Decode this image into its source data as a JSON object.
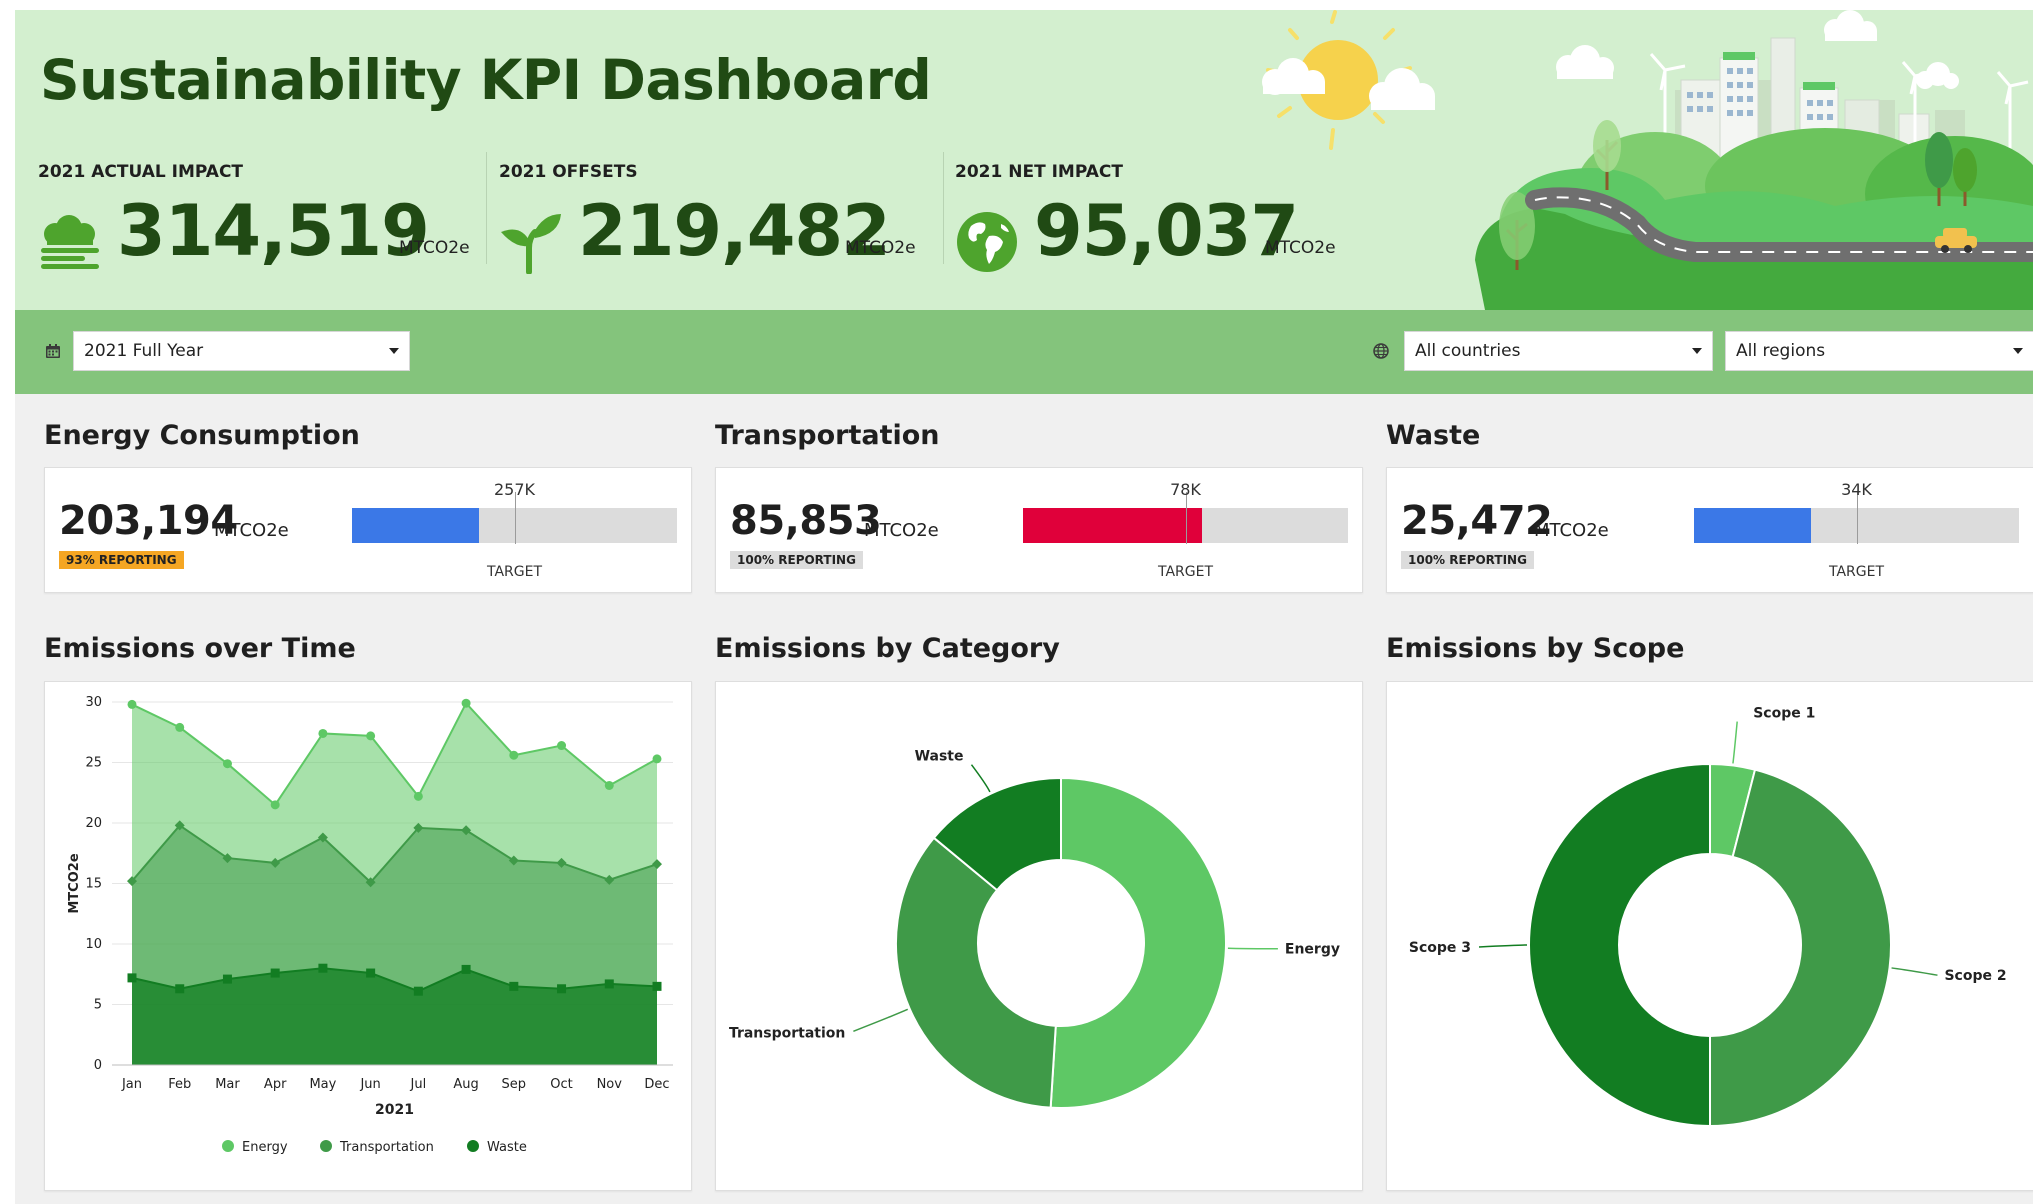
{
  "header": {
    "title": "Sustainability KPI Dashboard",
    "kpis": [
      {
        "label": "2021 ACTUAL IMPACT",
        "value": "314,519",
        "unit": "MTCO2e",
        "icon": "clouds-icon"
      },
      {
        "label": "2021 OFFSETS",
        "value": "219,482",
        "unit": "MTCO2e",
        "icon": "sprout-icon"
      },
      {
        "label": "2021 NET IMPACT",
        "value": "95,037",
        "unit": "MTCO2e",
        "icon": "globe-icon"
      }
    ]
  },
  "filters": {
    "period": "2021 Full Year",
    "country": "All countries",
    "region": "All regions",
    "period_icon": "calendar-icon",
    "location_icon": "globe-icon"
  },
  "sections": {
    "energy": "Energy Consumption",
    "transportation": "Transportation",
    "waste": "Waste",
    "over_time": "Emissions over Time",
    "by_category": "Emissions by Category",
    "by_scope": "Emissions by Scope"
  },
  "kpi_cards": [
    {
      "value": "203,194",
      "unit": "MTCO2e",
      "badge": "93% REPORTING",
      "badge_color": "#f5a623",
      "target_value": "257K",
      "target_label": "TARGET",
      "progress": 0.39,
      "target_position": 0.5,
      "bar_color": "#3b78e7"
    },
    {
      "value": "85,853",
      "unit": "MTCO2e",
      "badge": "100% REPORTING",
      "badge_color": "#dcdcdc",
      "target_value": "78K",
      "target_label": "TARGET",
      "progress": 0.55,
      "target_position": 0.5,
      "bar_color": "#e0003a"
    },
    {
      "value": "25,472",
      "unit": "MTCO2e",
      "badge": "100% REPORTING",
      "badge_color": "#dcdcdc",
      "target_value": "34K",
      "target_label": "TARGET",
      "progress": 0.36,
      "target_position": 0.5,
      "bar_color": "#3b78e7"
    }
  ],
  "colors": {
    "energy": "#5ec865",
    "transportation": "#3f9a48",
    "waste": "#127d22",
    "header_bg": "#d3efcf",
    "filter_bg": "#84c47c",
    "title_green": "#204a14"
  },
  "chart_data": [
    {
      "type": "area",
      "stacked": true,
      "title": "",
      "xlabel": "2021",
      "ylabel": "MTCO2e",
      "ylim": [
        0,
        30
      ],
      "yticks": [
        0,
        5,
        10,
        15,
        20,
        25,
        30
      ],
      "categories": [
        "Jan",
        "Feb",
        "Mar",
        "Apr",
        "May",
        "Jun",
        "Jul",
        "Aug",
        "Sep",
        "Oct",
        "Nov",
        "Dec"
      ],
      "grid": true,
      "legend": "bottom",
      "series": [
        {
          "name": "Energy",
          "cumulative": [
            29.8,
            27.9,
            24.9,
            21.5,
            27.4,
            27.2,
            22.2,
            29.9,
            25.6,
            26.4,
            23.1,
            25.3
          ],
          "values": [
            14.6,
            8.1,
            7.8,
            4.8,
            8.6,
            12.1,
            2.6,
            10.5,
            8.6,
            9.7,
            7.8,
            8.7
          ]
        },
        {
          "name": "Transportation",
          "cumulative": [
            15.2,
            19.8,
            17.1,
            16.7,
            18.8,
            15.1,
            19.6,
            19.4,
            16.9,
            16.7,
            15.3,
            16.6
          ],
          "values": [
            8.0,
            13.5,
            10.0,
            9.1,
            10.8,
            7.5,
            13.5,
            11.5,
            10.4,
            10.4,
            8.6,
            10.1
          ]
        },
        {
          "name": "Waste",
          "cumulative": [
            7.2,
            6.3,
            7.1,
            7.6,
            8.0,
            7.6,
            6.1,
            7.9,
            6.5,
            6.3,
            6.7,
            6.5
          ],
          "values": [
            7.2,
            6.3,
            7.1,
            7.6,
            8.0,
            7.6,
            6.1,
            7.9,
            6.5,
            6.3,
            6.7,
            6.5
          ]
        }
      ]
    },
    {
      "type": "pie",
      "donut": true,
      "title": "",
      "categories": [
        "Energy",
        "Transportation",
        "Waste"
      ],
      "values": [
        51,
        35,
        14
      ]
    },
    {
      "type": "pie",
      "donut": true,
      "title": "",
      "categories": [
        "Scope 1",
        "Scope 2",
        "Scope 3"
      ],
      "values": [
        4,
        46,
        50
      ]
    }
  ]
}
